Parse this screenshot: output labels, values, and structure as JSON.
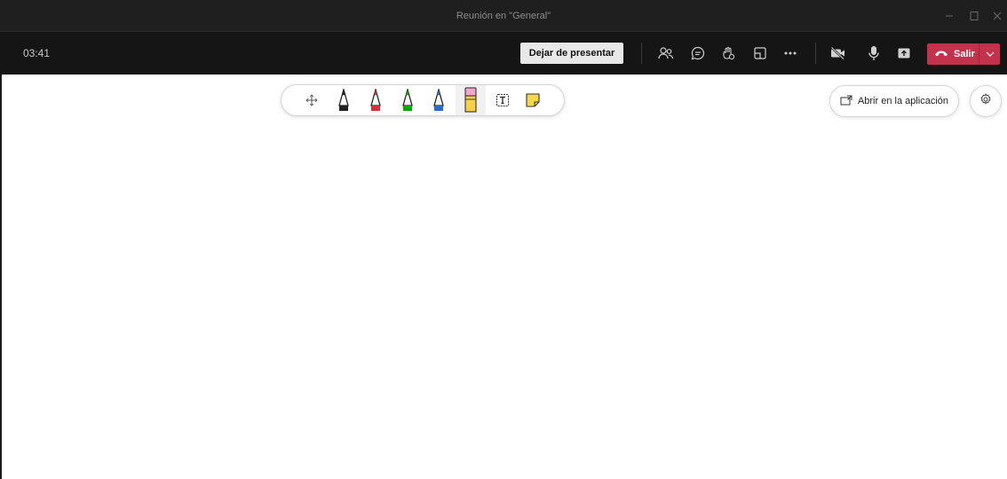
{
  "window": {
    "title": "Reunión en \"General\"",
    "controls": [
      "minimize-icon",
      "maximize-icon",
      "close-icon"
    ]
  },
  "call_bar": {
    "timer": "03:41",
    "stop_presenting_label": "Dejar de presentar",
    "icons": [
      "participants-icon",
      "chat-icon",
      "reactions-icon",
      "rooms-icon",
      "more-icon",
      "camera-off-icon",
      "microphone-icon",
      "share-tray-icon"
    ],
    "leave_label": "Salir",
    "leave_color": "#c4314b"
  },
  "whiteboard": {
    "tools": [
      {
        "name": "move-tool-icon"
      },
      {
        "name": "pen-black-icon",
        "color": "#222222"
      },
      {
        "name": "pen-red-icon",
        "color": "#d13438"
      },
      {
        "name": "pen-green-icon",
        "color": "#13a10e"
      },
      {
        "name": "pen-blue-icon",
        "color": "#2b6cc4"
      },
      {
        "name": "eraser-icon",
        "color": "#f7d04a",
        "selected": true
      },
      {
        "name": "text-tool-icon"
      },
      {
        "name": "sticky-note-icon",
        "color": "#f8d84a"
      }
    ],
    "open_in_app_label": "Abrir en la aplicación"
  }
}
